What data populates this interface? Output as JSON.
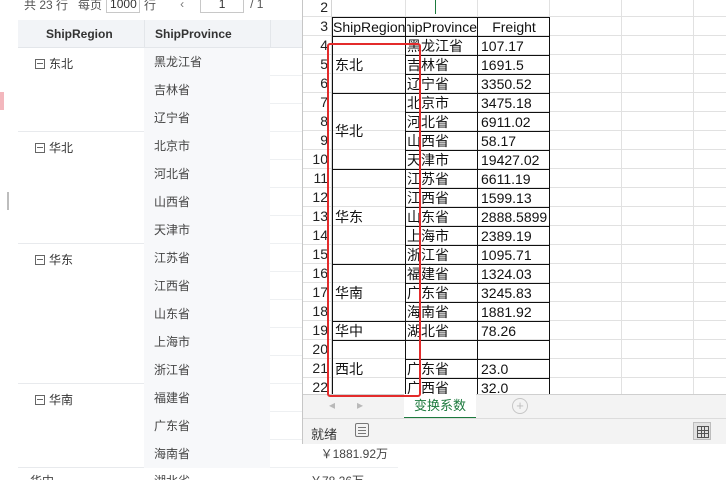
{
  "report": {
    "pager": {
      "total": "共 23 行",
      "per_page_label": "每页",
      "per_page_value": "1000",
      "unit": "行",
      "nav": "‹",
      "current_page": "1",
      "total_pages": "/ 1"
    },
    "headers": [
      "ShipRegion",
      "ShipProvince"
    ],
    "groups": [
      {
        "region": "东北",
        "provinces": [
          "黑龙江省",
          "吉林省",
          "辽宁省"
        ]
      },
      {
        "region": "华北",
        "provinces": [
          "北京市",
          "河北省",
          "山西省",
          "天津市"
        ]
      },
      {
        "region": "华东",
        "provinces": [
          "江苏省",
          "江西省",
          "山东省",
          "上海市",
          "浙江省"
        ]
      },
      {
        "region": "华南",
        "provinces": [
          "福建省",
          "广东省",
          "海南省"
        ]
      }
    ],
    "hainan_freight": "￥1881.92万",
    "last_row": {
      "region": "华中",
      "province": "湖北省",
      "freight": "￥78.26万"
    }
  },
  "sheet": {
    "rows": [
      "2",
      "3",
      "4",
      "5",
      "6",
      "7",
      "8",
      "9",
      "10",
      "11",
      "12",
      "13",
      "14",
      "15",
      "16",
      "17",
      "18",
      "19",
      "20",
      "21",
      "22"
    ],
    "header_row": {
      "a": "ShipRegion",
      "b": "ShipProvince",
      "c": "Freight"
    },
    "regions": [
      {
        "label": "东北"
      },
      {
        "label": "华北"
      },
      {
        "label": "华东"
      },
      {
        "label": "华南"
      },
      {
        "label": "华中"
      },
      {
        "label": "西北"
      }
    ],
    "data": [
      {
        "p": "黑龙江省",
        "f": "107.17"
      },
      {
        "p": "吉林省",
        "f": "1691.5"
      },
      {
        "p": "辽宁省",
        "f": "3350.52"
      },
      {
        "p": "北京市",
        "f": "3475.18"
      },
      {
        "p": "河北省",
        "f": "6911.02"
      },
      {
        "p": "山西省",
        "f": "58.17"
      },
      {
        "p": "天津市",
        "f": "19427.02"
      },
      {
        "p": "江苏省",
        "f": "6611.19"
      },
      {
        "p": "江西省",
        "f": "1599.13"
      },
      {
        "p": "山东省",
        "f": "2888.5899"
      },
      {
        "p": "上海市",
        "f": "2389.19"
      },
      {
        "p": "浙江省",
        "f": "1095.71"
      },
      {
        "p": "福建省",
        "f": "1324.03"
      },
      {
        "p": "广东省",
        "f": "3245.83"
      },
      {
        "p": "海南省",
        "f": "1881.92"
      },
      {
        "p": "湖北省",
        "f": "78.26"
      },
      {
        "p": "",
        "f": ""
      },
      {
        "p": "广东省",
        "f": "23.0"
      },
      {
        "p": "广西省",
        "f": "32.0"
      }
    ],
    "sheet_tab": "变换系数",
    "add_sheet_icon": "plus-icon",
    "status_text": "就绪",
    "accessibility_icon": "accessibility-icon",
    "view_icon": "normal-view-icon",
    "accent_color": "#1d7a3e",
    "highlight_color": "#e32b2b"
  }
}
